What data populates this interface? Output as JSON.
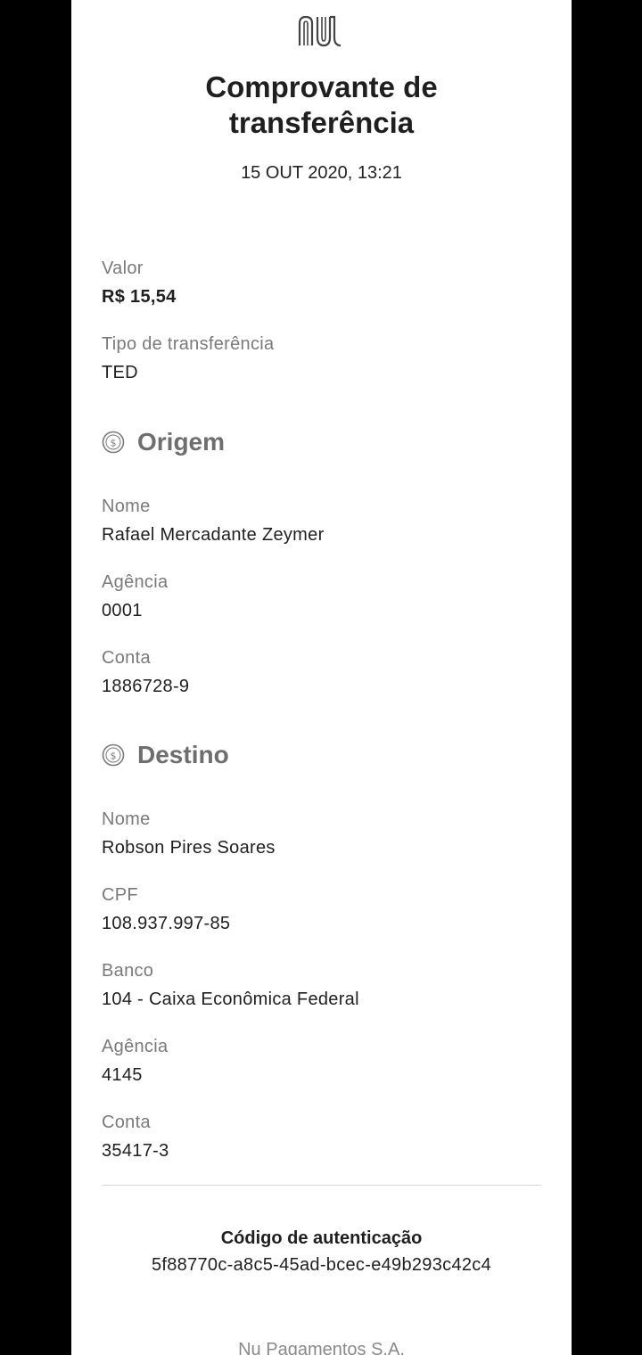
{
  "header": {
    "logo_icon": "nubank-logo-icon",
    "title": "Comprovante de\ntransferência",
    "timestamp": "15 OUT 2020, 13:21"
  },
  "summary": {
    "valor_label": "Valor",
    "valor": "R$ 15,54",
    "tipo_label": "Tipo de transferência",
    "tipo": "TED"
  },
  "origem": {
    "icon": "money-circle-icon",
    "heading": "Origem",
    "nome_label": "Nome",
    "nome": "Rafael Mercadante Zeymer",
    "agencia_label": "Agência",
    "agencia": "0001",
    "conta_label": "Conta",
    "conta": "1886728-9"
  },
  "destino": {
    "icon": "money-circle-icon",
    "heading": "Destino",
    "nome_label": "Nome",
    "nome": "Robson Pires Soares",
    "cpf_label": "CPF",
    "cpf": "108.937.997-85",
    "banco_label": "Banco",
    "banco": "104 - Caixa Econômica Federal",
    "agencia_label": "Agência",
    "agencia": "4145",
    "conta_label": "Conta",
    "conta": "35417-3"
  },
  "authentication": {
    "label": "Código de autenticação",
    "code": "5f88770c-a8c5-45ad-bcec-e49b293c42c4"
  },
  "footer": {
    "company": "Nu Pagamentos S.A."
  },
  "colors": {
    "background": "#000000",
    "paper": "#ffffff",
    "label_gray": "#7a7a7a",
    "heading_gray": "#6e6e6e",
    "text": "#1f1f1f"
  }
}
